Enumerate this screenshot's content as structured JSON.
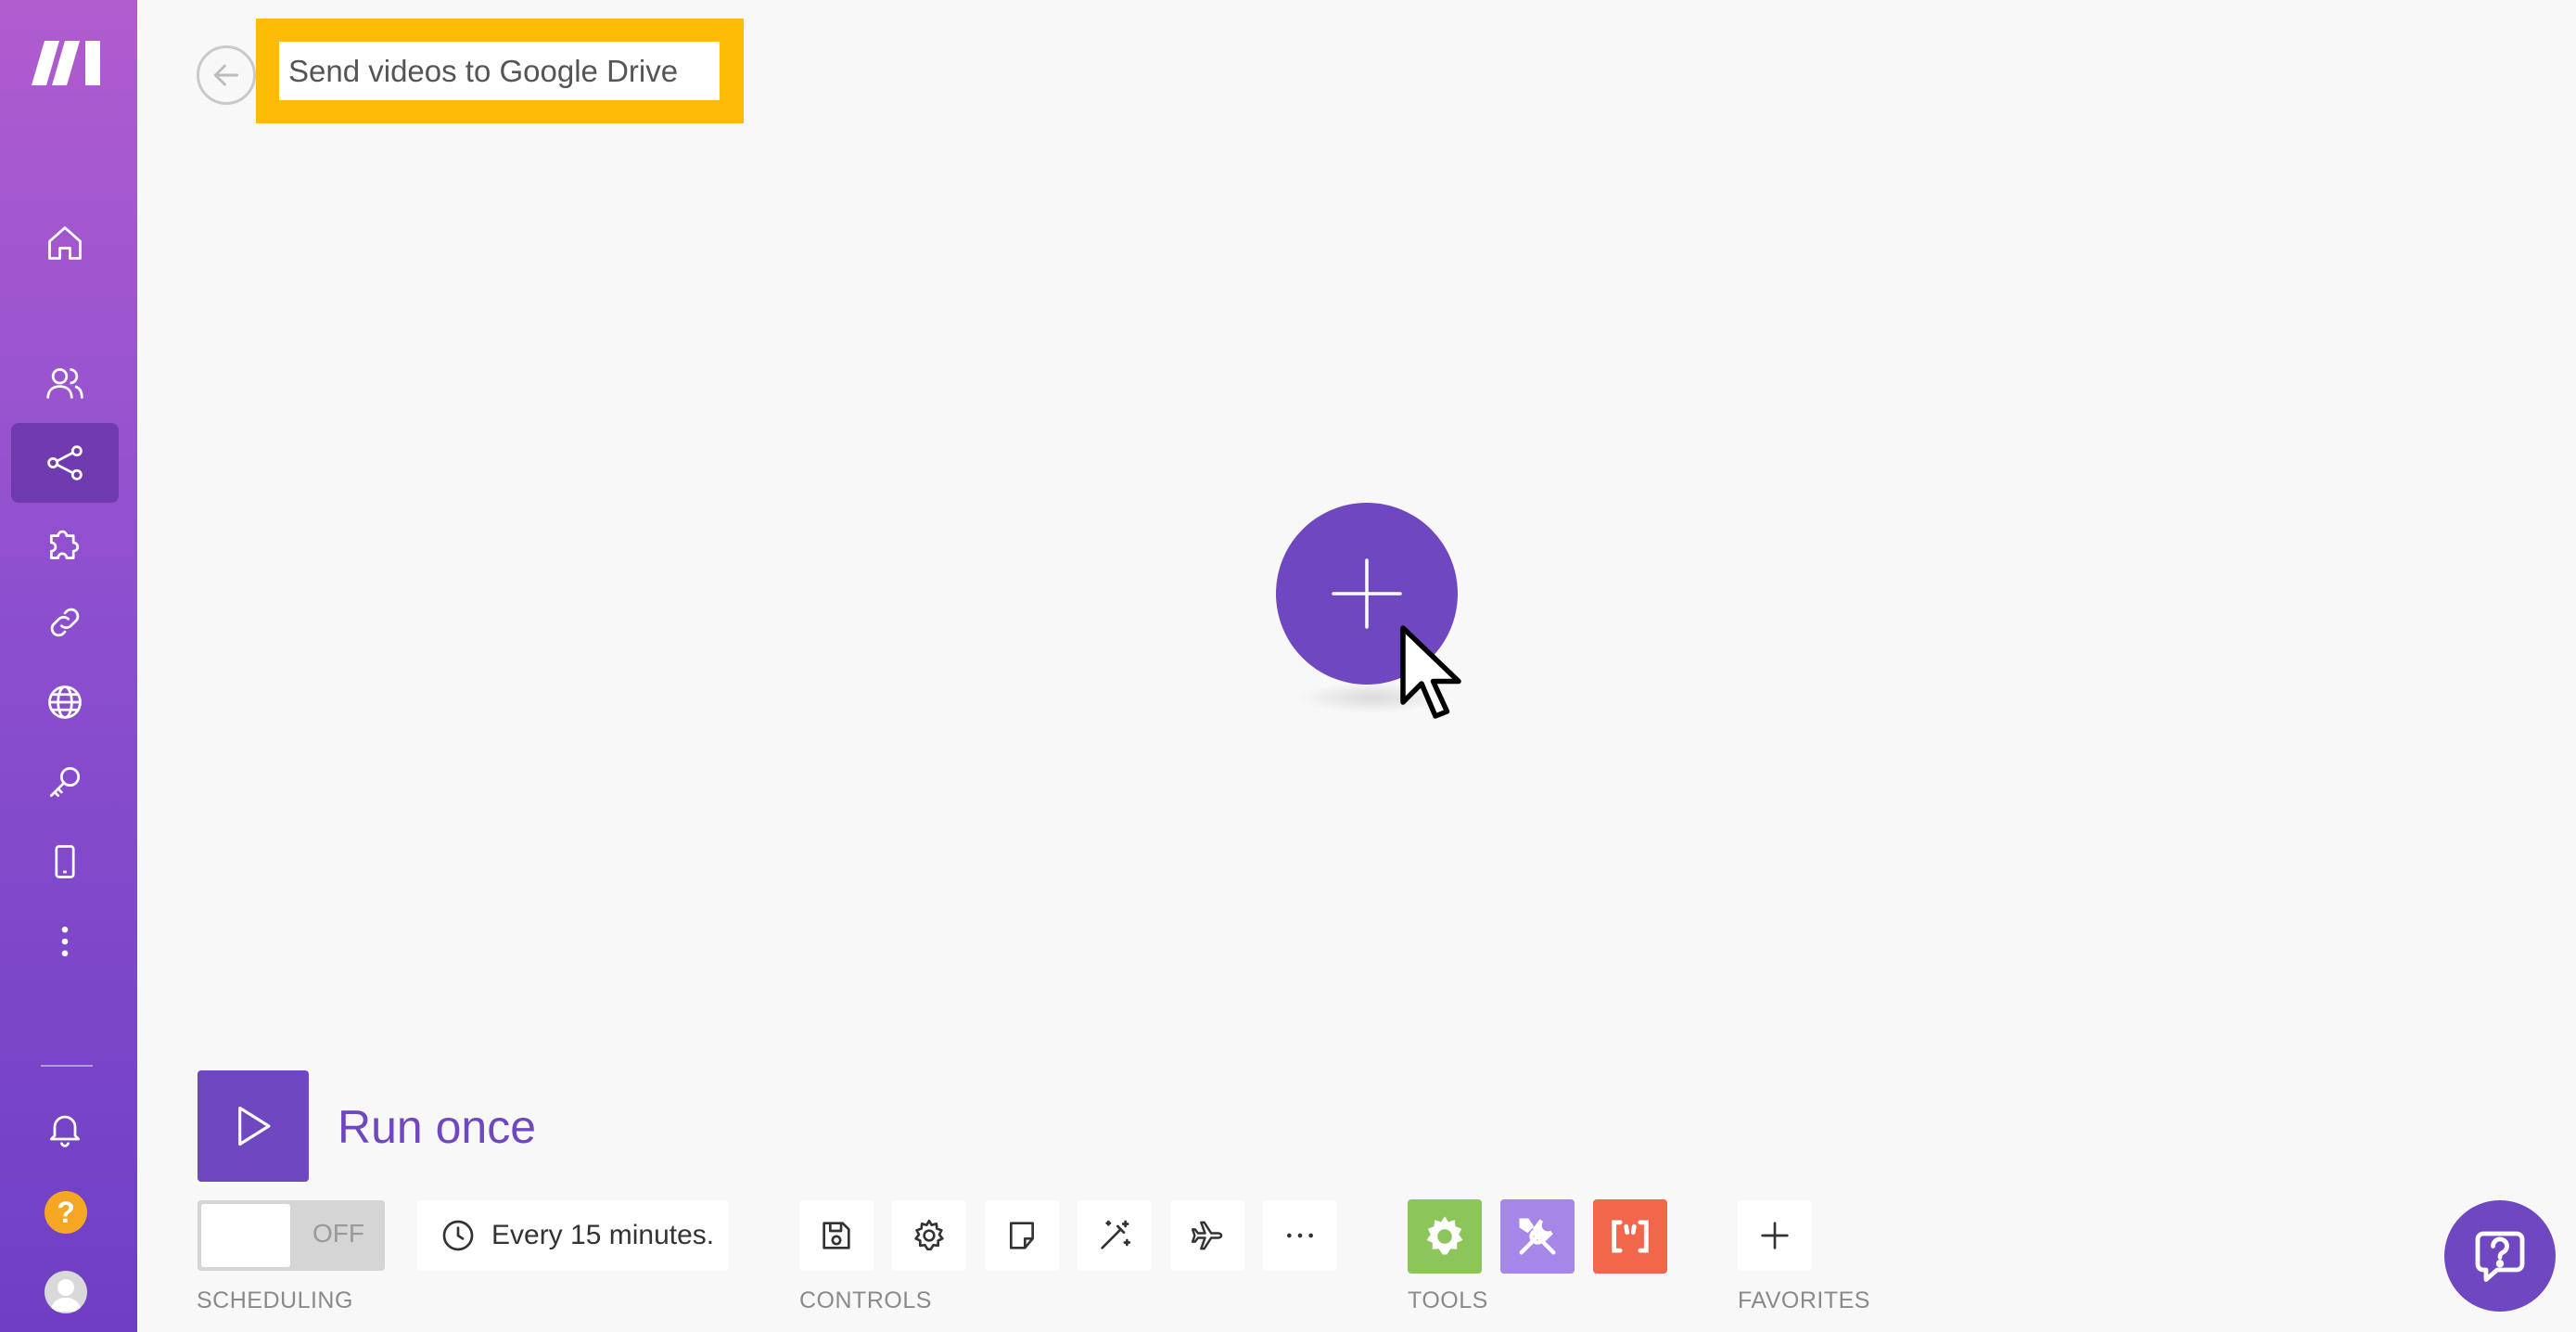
{
  "header": {
    "scenario_name": "Send videos to Google Drive",
    "back_icon": "arrow-left-icon"
  },
  "sidebar": {
    "items": [
      {
        "id": "home",
        "icon": "home-icon"
      },
      {
        "id": "team",
        "icon": "users-icon"
      },
      {
        "id": "scenarios",
        "icon": "share-icon",
        "active": true
      },
      {
        "id": "apps",
        "icon": "puzzle-icon"
      },
      {
        "id": "connections",
        "icon": "link-icon"
      },
      {
        "id": "webhooks",
        "icon": "globe-icon"
      },
      {
        "id": "keys",
        "icon": "key-icon"
      },
      {
        "id": "devices",
        "icon": "phone-icon"
      },
      {
        "id": "more",
        "icon": "more-vertical-icon"
      }
    ],
    "bottom": {
      "notifications": "bell-icon",
      "help": "?",
      "profile": "avatar"
    }
  },
  "canvas": {
    "add_module_icon": "plus-icon"
  },
  "toolbar": {
    "run_once_label": "Run once",
    "scheduling": {
      "toggle_state": "OFF",
      "interval_text": "Every 15 minutes.",
      "section_label": "SCHEDULING"
    },
    "controls": {
      "section_label": "CONTROLS",
      "items": [
        "save-icon",
        "settings-icon",
        "note-icon",
        "magic-wand-icon",
        "airplane-icon",
        "more-horizontal-icon"
      ]
    },
    "tools": {
      "section_label": "TOOLS",
      "items": [
        {
          "icon": "gear-tool-icon",
          "color": "#8cc65a"
        },
        {
          "icon": "wrench-tool-icon",
          "color": "#a687e8"
        },
        {
          "icon": "bracket-tool-icon",
          "color": "#f2664c"
        }
      ]
    },
    "favorites": {
      "section_label": "FAVORITES",
      "add_icon": "plus-icon"
    }
  },
  "colors": {
    "brand": "#6f47c0",
    "highlight": "#fcbc06"
  }
}
